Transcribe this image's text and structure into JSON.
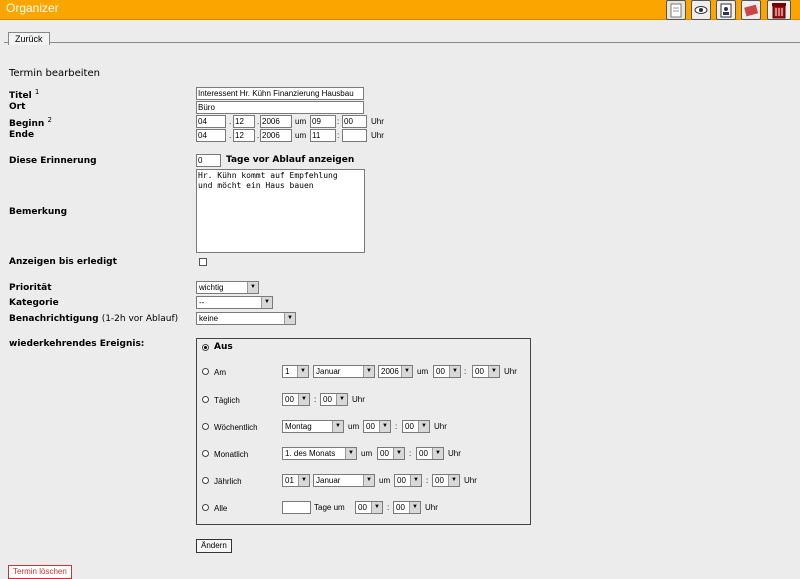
{
  "app": {
    "title": "Organizer"
  },
  "toolbar": {
    "icons": [
      "notepad-icon",
      "eye-icon",
      "contacts-icon",
      "tools-icon",
      "trash-icon"
    ]
  },
  "nav": {
    "back_label": "Zurück"
  },
  "form": {
    "heading": "Termin bearbeiten",
    "titel_label": "Titel",
    "titel_sup": "1",
    "titel_value": "Interessent Hr. Kühn Finanzierung Hausbau",
    "ort_label": "Ort",
    "ort_value": "Büro",
    "beginn_label": "Beginn",
    "beginn_sup": "2",
    "beginn": {
      "day": "04",
      "month": "12",
      "year": "2006",
      "hour": "09",
      "minute": "00"
    },
    "ende_label": "Ende",
    "ende": {
      "day": "04",
      "month": "12",
      "year": "2006",
      "hour": "11",
      "minute": ""
    },
    "dot": ".",
    "colon": ":",
    "um": "um",
    "uhr": "Uhr",
    "erinnerung_label": "Diese Erinnerung",
    "erinnerung_value": "0",
    "erinnerung_suffix": "Tage vor Ablauf anzeigen",
    "bemerkung_label": "Bemerkung",
    "bemerkung_value": "Hr. Kühn kommt auf Empfehlung\nund möcht ein Haus bauen",
    "anzeigen_label": "Anzeigen bis erledigt",
    "prioritaet_label": "Priorität",
    "prioritaet_value": "wichtig",
    "kategorie_label": "Kategorie",
    "kategorie_value": "--",
    "benachrichtigung_label": "Benachrichtigung",
    "benachrichtigung_note": "(1-2h vor Ablauf)",
    "benachrichtigung_value": "keine",
    "wiederkehrend_label": "wiederkehrendes Ereignis:"
  },
  "recurrence": {
    "aus": "Aus",
    "am": {
      "label": "Am",
      "day": "1",
      "month": "Januar",
      "year": "2006",
      "hour": "00",
      "minute": "00"
    },
    "taeglich": {
      "label": "Täglich",
      "hour": "00",
      "minute": "00"
    },
    "woechentlich": {
      "label": "Wöchentlich",
      "weekday": "Montag",
      "hour": "00",
      "minute": "00"
    },
    "monatlich": {
      "label": "Monatlich",
      "day": "1. des Monats",
      "hour": "00",
      "minute": "00"
    },
    "jaehrlich": {
      "label": "Jährlich",
      "day": "01",
      "month": "Januar",
      "hour": "00",
      "minute": "00"
    },
    "alle": {
      "label": "Alle",
      "days": "",
      "suffix": "Tage um",
      "hour": "00",
      "minute": "00"
    }
  },
  "actions": {
    "aendern": "Ändern",
    "loeschen": "Termin löschen"
  }
}
